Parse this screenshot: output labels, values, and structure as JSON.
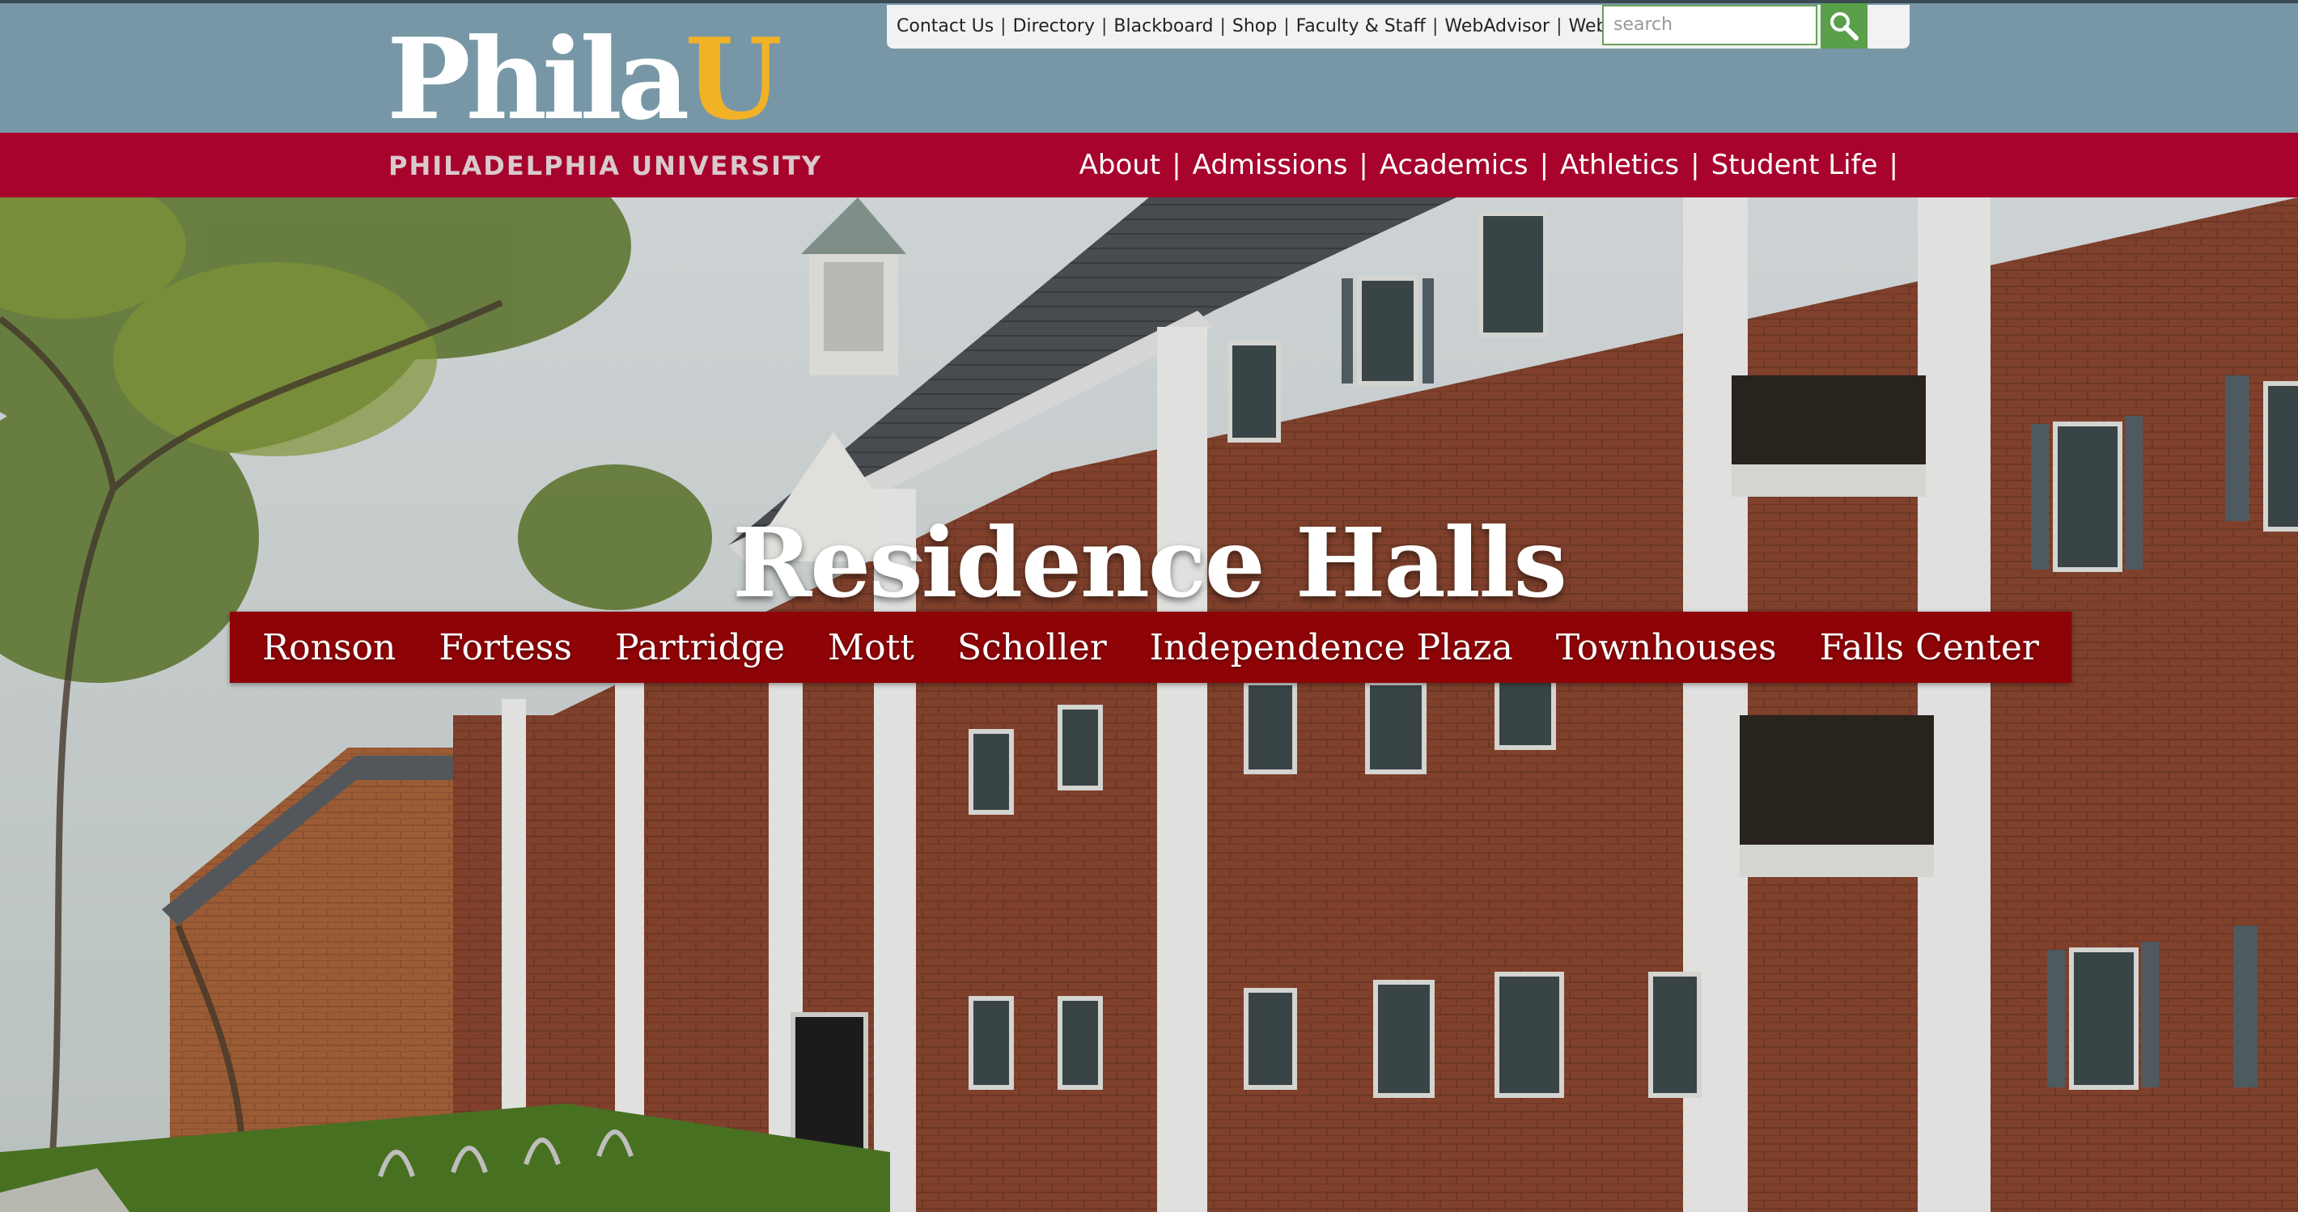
{
  "utility_links": [
    "Contact Us",
    "Directory",
    "Blackboard",
    "Shop",
    "Faculty & Staff",
    "WebAdvisor",
    "Web Mail"
  ],
  "search": {
    "placeholder": "search",
    "icon": "magnifier-icon"
  },
  "logo": {
    "phila": "Phila",
    "u": "U",
    "university_name": "PHILADELPHIA UNIVERSITY"
  },
  "main_nav": [
    "About",
    "Admissions",
    "Academics",
    "Athletics",
    "Student Life"
  ],
  "hero": {
    "title": "Residence Halls",
    "halls": [
      "Ronson",
      "Fortess",
      "Partridge",
      "Mott",
      "Scholler",
      "Independence Plaza",
      "Townhouses",
      "Falls Center"
    ]
  },
  "colors": {
    "top_band": "#7797a6",
    "nav_red": "#a7032d",
    "hall_bar": "#8e0306",
    "logo_gold": "#f2b226",
    "search_green": "#5aa04a"
  }
}
